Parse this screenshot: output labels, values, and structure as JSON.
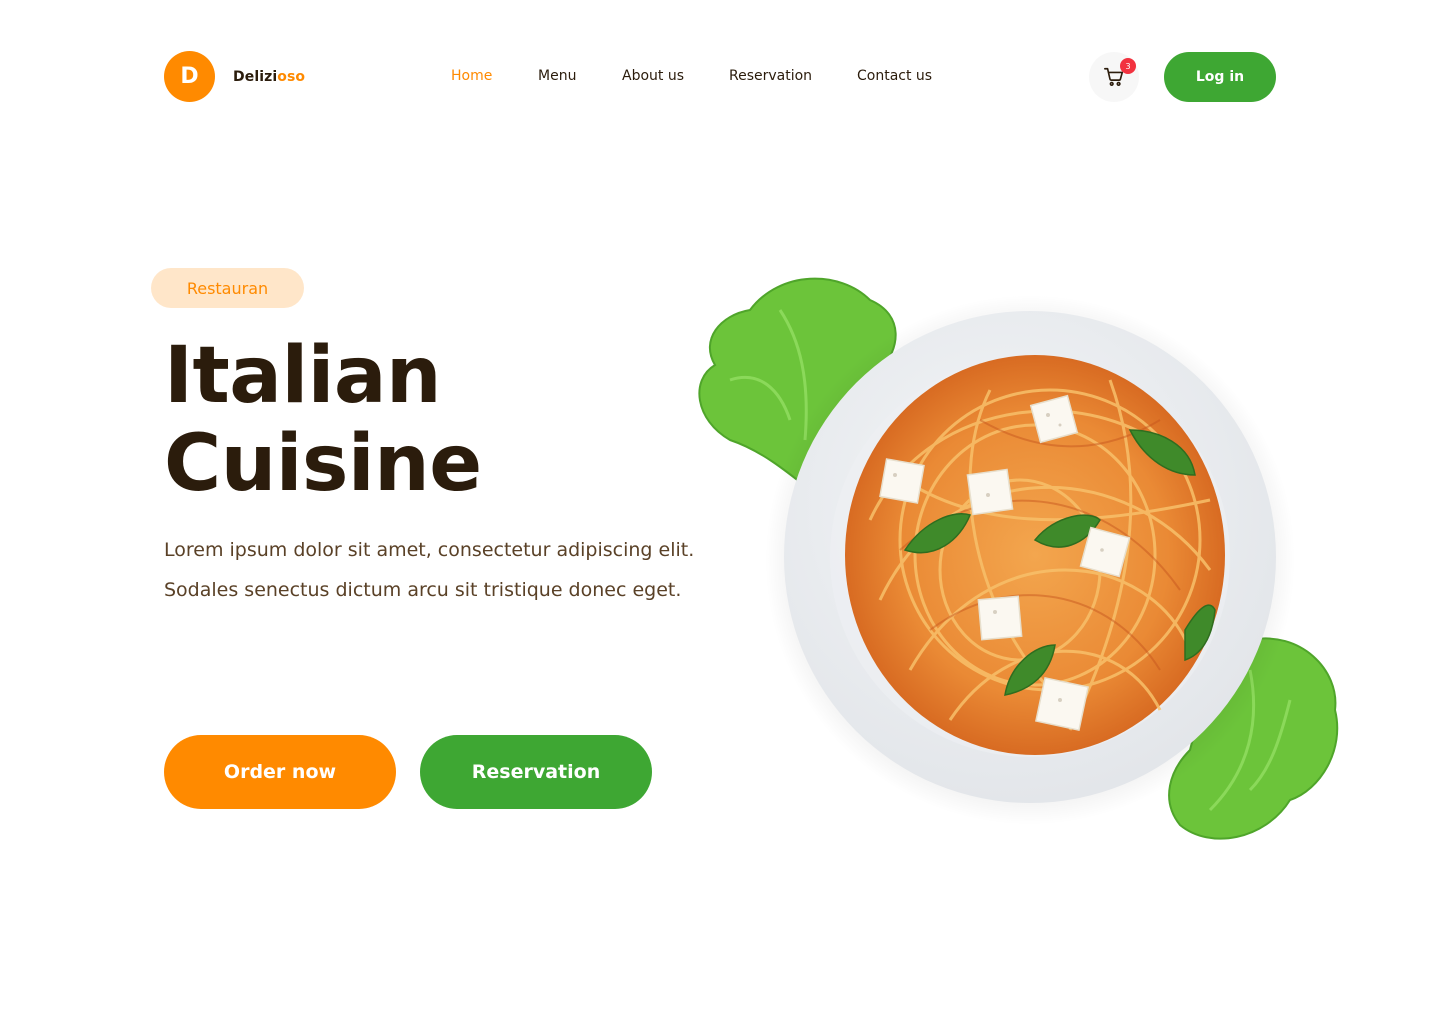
{
  "brand": {
    "badge_letter": "D",
    "name_part1": "Delizi",
    "name_part2": "oso"
  },
  "nav": {
    "items": [
      {
        "label": "Home",
        "active": true
      },
      {
        "label": "Menu",
        "active": false
      },
      {
        "label": "About us",
        "active": false
      },
      {
        "label": "Reservation",
        "active": false
      },
      {
        "label": "Contact us",
        "active": false
      }
    ]
  },
  "cart": {
    "icon": "cart-icon",
    "count": "3"
  },
  "header": {
    "login_label": "Log in"
  },
  "hero": {
    "tag": "Restauran",
    "title_line1": "Italian",
    "title_line2": "Cuisine",
    "description": "Lorem ipsum dolor sit amet, consectetur adipiscing elit. Sodales senectus dictum arcu sit tristique donec eget.",
    "order_label": "Order now",
    "reservation_label": "Reservation",
    "image": "spaghetti-plate-image"
  },
  "colors": {
    "accent_orange": "#ff8a00",
    "accent_green": "#3ea733",
    "text_dark": "#2b1c0c",
    "tag_bg": "#ffe6c9",
    "badge_red": "#f2323f"
  }
}
